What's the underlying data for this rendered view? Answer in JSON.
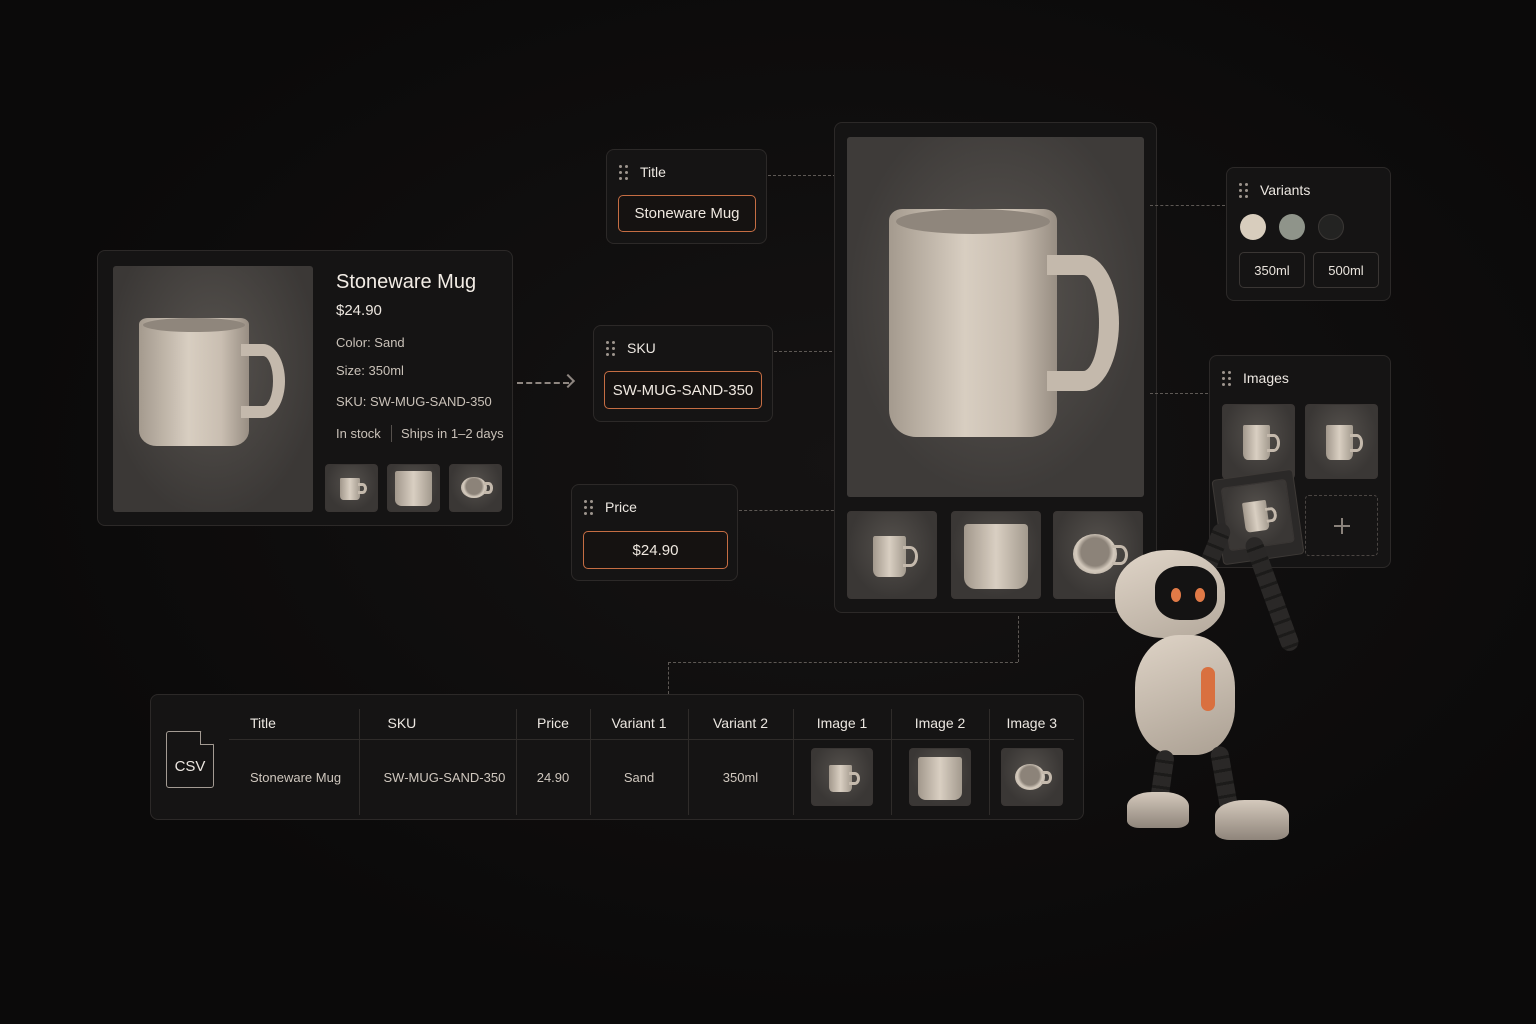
{
  "product_card": {
    "title": "Stoneware Mug",
    "price": "$24.90",
    "color": "Color: Sand",
    "size": "Size: 350ml",
    "sku": "SKU: SW-MUG-SAND-350",
    "stock": "In stock",
    "shipping": "Ships in 1–2 days"
  },
  "fields": {
    "title": {
      "label": "Title",
      "value": "Stoneware Mug"
    },
    "sku": {
      "label": "SKU",
      "value": "SW-MUG-SAND-350"
    },
    "price": {
      "label": "Price",
      "value": "$24.90"
    }
  },
  "variants": {
    "label": "Variants",
    "swatches": [
      "#d8cdbd",
      "#8f948a",
      "#232322"
    ],
    "sizes": [
      "350ml",
      "500ml"
    ]
  },
  "images": {
    "label": "Images",
    "add_icon": "plus-icon"
  },
  "csv": {
    "file_label": "CSV",
    "headers": [
      "Title",
      "SKU",
      "Price",
      "Variant 1",
      "Variant 2",
      "Image 1",
      "Image 2",
      "Image 3"
    ],
    "row": [
      "Stoneware Mug",
      "SW-MUG-SAND-350",
      "24.90",
      "Sand",
      "350ml"
    ]
  },
  "colors": {
    "accent": "#c56d43",
    "background": "#0c0b0b"
  }
}
